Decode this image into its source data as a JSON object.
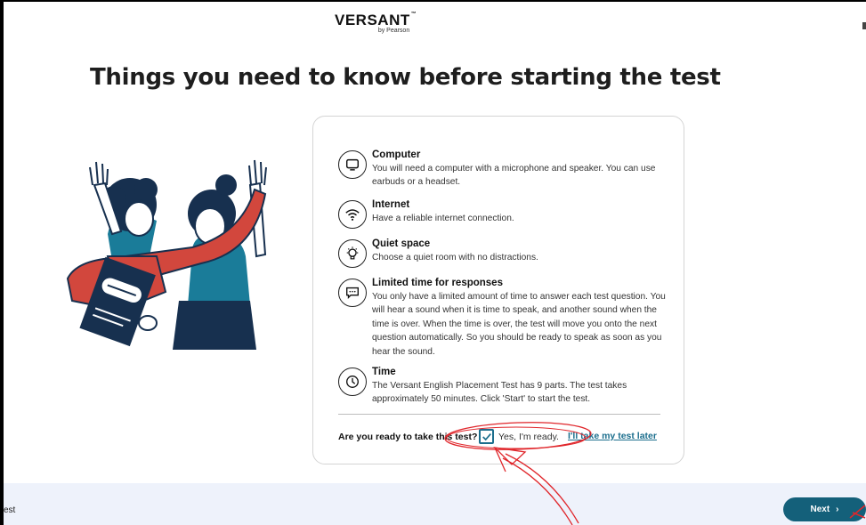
{
  "brand": {
    "name": "VERSANT",
    "tm": "™",
    "sub": "by Pearson"
  },
  "page": {
    "title": "Things you need to know before starting the test"
  },
  "checklist": [
    {
      "icon": "computer-icon",
      "title": "Computer",
      "desc": "You will need a computer with a microphone and speaker. You can use earbuds or a headset."
    },
    {
      "icon": "wifi-icon",
      "title": "Internet",
      "desc": "Have a reliable internet connection."
    },
    {
      "icon": "lightbulb-icon",
      "title": "Quiet space",
      "desc": "Choose a quiet room with no distractions."
    },
    {
      "icon": "chat-bubble-icon",
      "title": "Limited time for responses",
      "desc": "You only have a limited amount of time to answer each test question. You will hear a sound when it is time to speak, and another sound when the time is over. When the time is over, the test will move you onto the next question automatically. So you should be ready to speak as soon as you hear the sound."
    },
    {
      "icon": "clock-icon",
      "title": "Time",
      "desc": "The Versant English Placement Test has 9 parts. The test takes approximately 50 minutes. Click 'Start' to start the test."
    }
  ],
  "ready": {
    "question": "Are you ready to take this test?",
    "checkbox_label": "Yes, I'm ready.",
    "checked": true,
    "later_link": "I'll take my test later"
  },
  "footer": {
    "left_text": "est",
    "next_label": "Next",
    "next_chevron": "›"
  },
  "colors": {
    "accent": "#1b6e8d",
    "button": "#14607a",
    "annotation": "#e0262b",
    "illustration_red": "#d2473d",
    "illustration_teal": "#1a7c99",
    "illustration_navy": "#17304f"
  }
}
